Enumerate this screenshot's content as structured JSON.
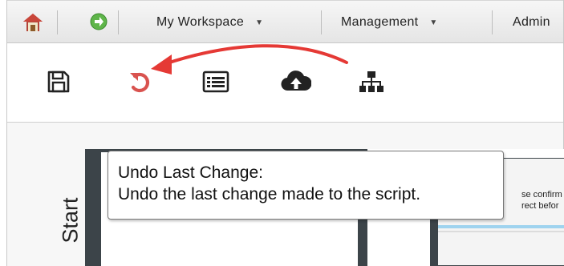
{
  "nav": {
    "home_icon": "house-icon",
    "go_icon": "green-arrow-icon",
    "items": [
      {
        "label": "My Workspace"
      },
      {
        "label": "Management"
      },
      {
        "label": "Admin"
      }
    ]
  },
  "toolbar": {
    "tools": [
      "save-icon",
      "undo-icon",
      "list-icon",
      "cloud-upload-icon",
      "sitemap-icon"
    ]
  },
  "canvas": {
    "start_label": "Start",
    "confirm_text_line1": "se confirm",
    "confirm_text_line2": "rect befor"
  },
  "tooltip": {
    "title": "Undo Last Change:",
    "body": "Undo the last change made to the script."
  },
  "colors": {
    "undo_red": "#d9534f",
    "arrow_red": "#e53935",
    "panel_dark": "#3c4449",
    "accent_blue": "#9fd3ef"
  }
}
